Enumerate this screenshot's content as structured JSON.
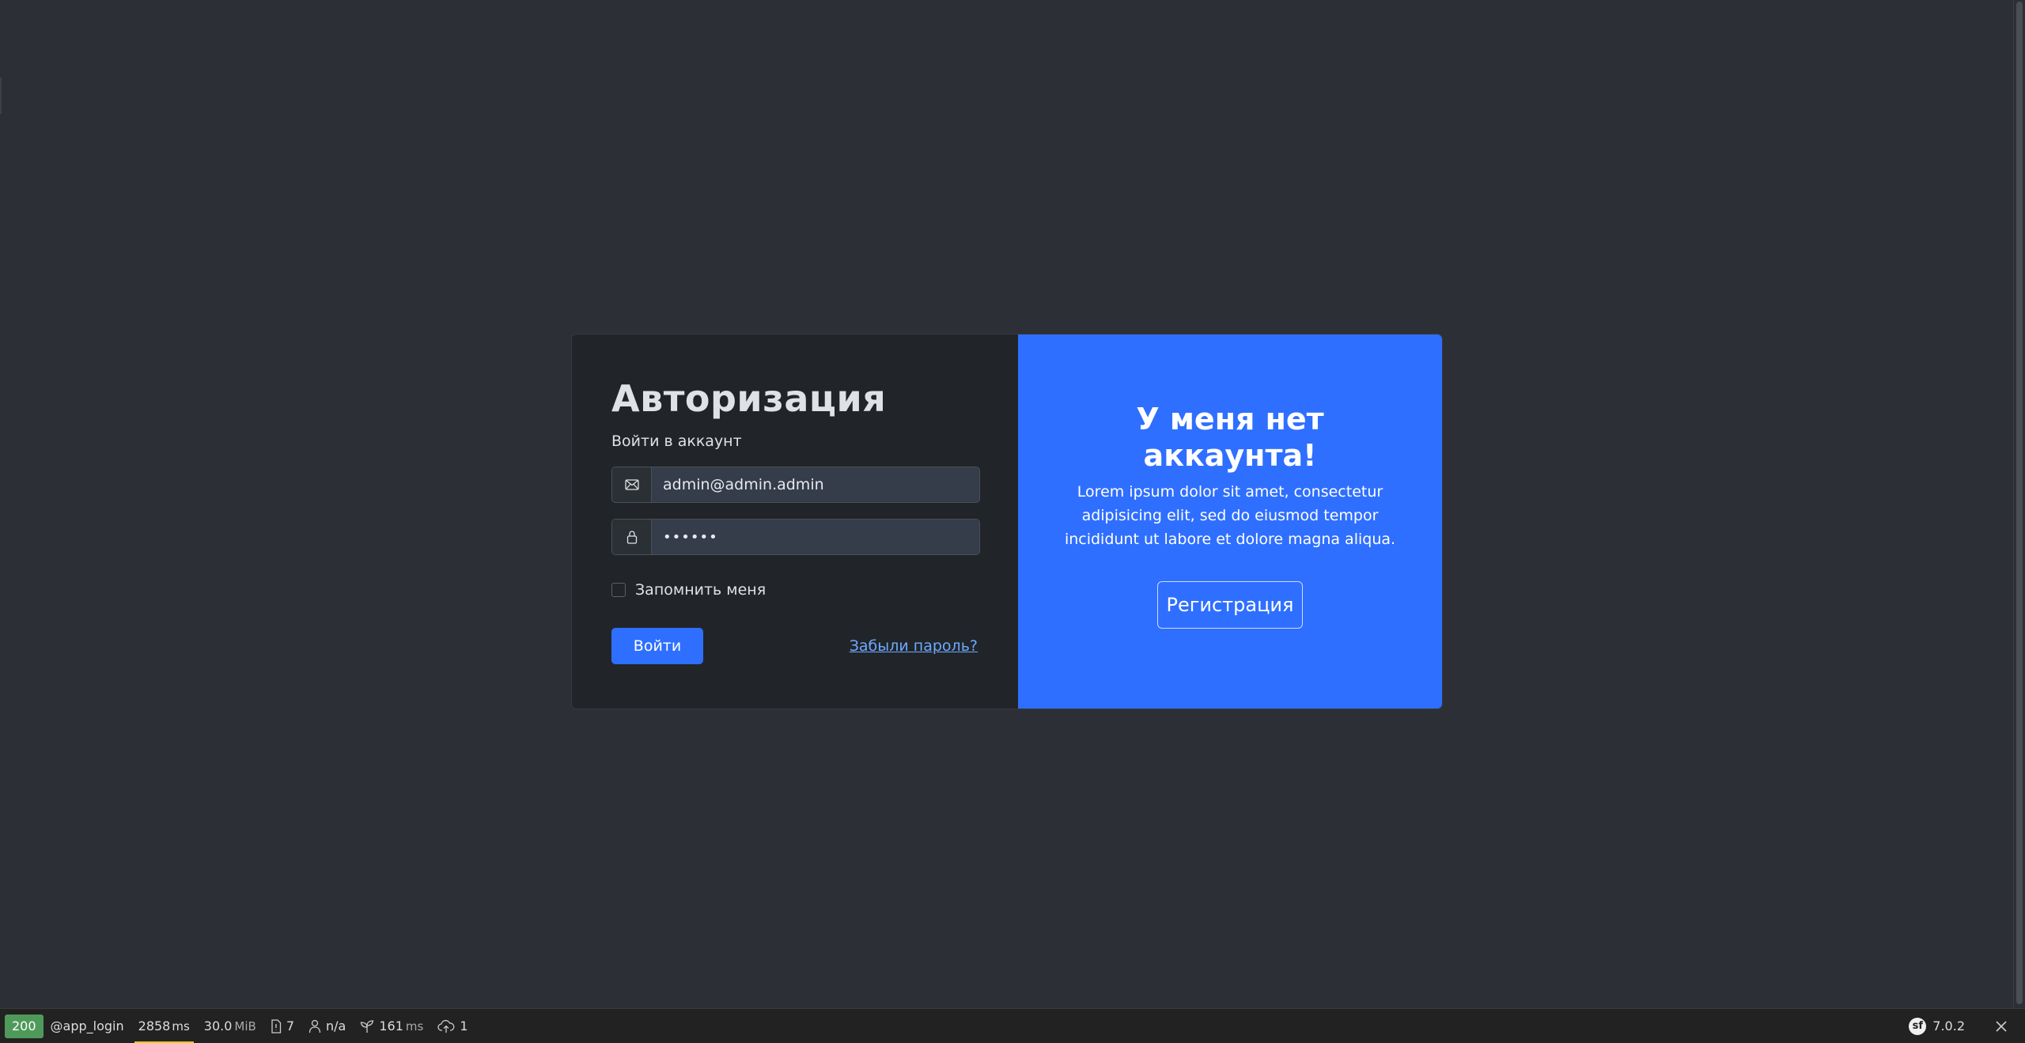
{
  "login": {
    "title": "Авторизация",
    "subtitle": "Войти в аккаунт",
    "email_value": "admin@admin.admin",
    "password_value": "••••••",
    "remember_label": "Запомнить меня",
    "submit_label": "Войти",
    "forgot_label": "Забыли пароль?"
  },
  "register": {
    "title": "У меня нет аккаунта!",
    "text": "Lorem ipsum dolor sit amet, consectetur adipisicing elit, sed do eiusmod tempor incididunt ut labore et dolore magna aliqua.",
    "button_label": "Регистрация"
  },
  "toolbar": {
    "status_code": "200",
    "route": "@app_login",
    "time_value": "2858",
    "time_unit": "ms",
    "memory_value": "30.0",
    "memory_unit": "MiB",
    "logs_count": "7",
    "user": "n/a",
    "twig_time": "161",
    "twig_unit": "ms",
    "http_requests": "1",
    "symfony_version": "7.0.2",
    "status_color": "#4f9a5a"
  },
  "theme": {
    "background": "#2c3036",
    "card_dark": "#212529",
    "accent": "#2f6fff",
    "link": "#6ea8fe"
  }
}
